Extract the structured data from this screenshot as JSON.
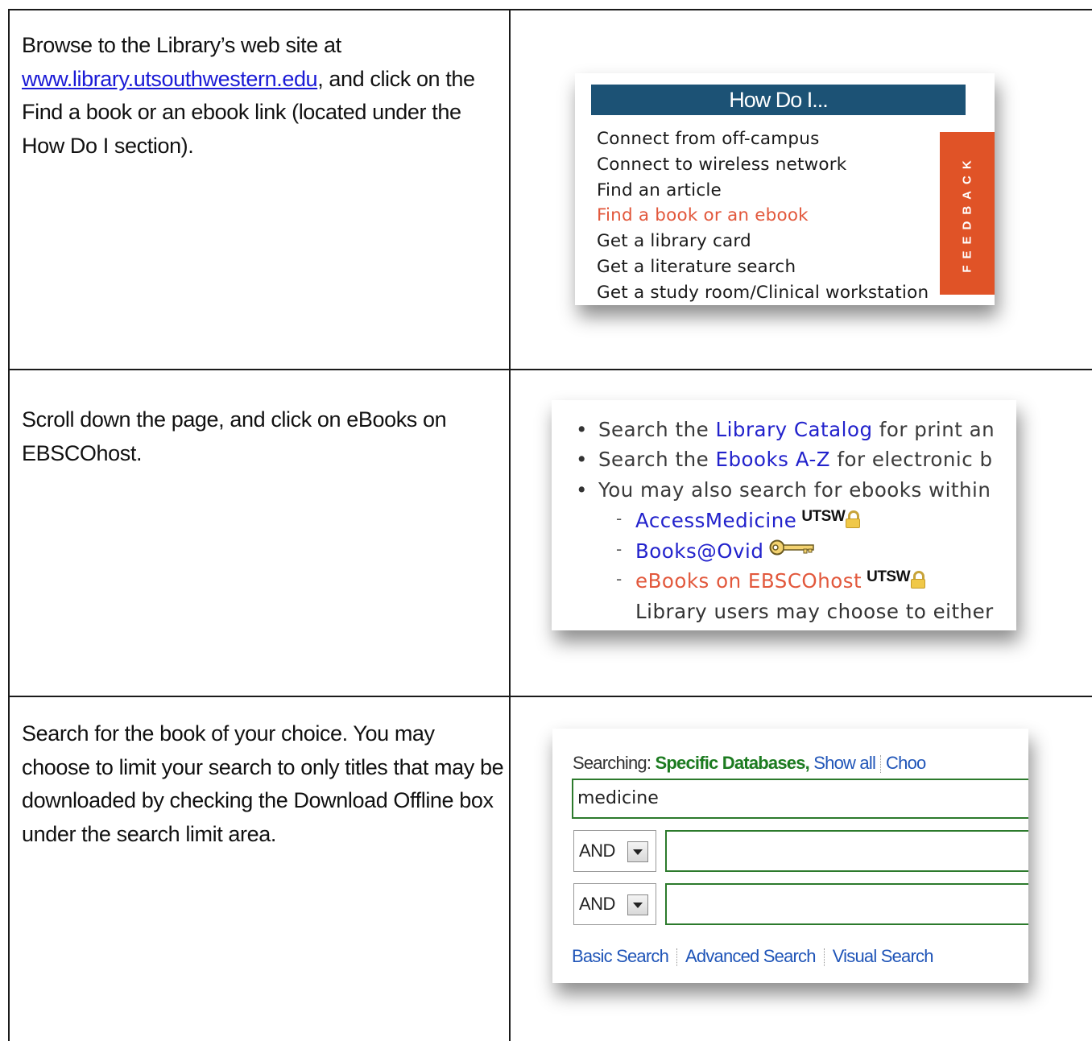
{
  "rows": [
    {
      "instruction_pre": "Browse to the Library’s web site at ",
      "instruction_link": "www.library.utsouthwestern.edu",
      "instruction_post": ", and click on the Find a book or an ebook link (located under the How Do I section)."
    },
    {
      "instruction": "Scroll down the page, and click on eBooks on EBSCOhost."
    },
    {
      "instruction": "Search for the book of your choice. You may choose to limit your search to only titles that may be downloaded by checking the Download Offline box under the search limit area."
    }
  ],
  "howdo": {
    "title": "How Do I...",
    "items": [
      "Connect from off-campus",
      "Connect to wireless network",
      "Find an article",
      "Find a book or an ebook",
      "Get a library card",
      "Get a literature search",
      "Get a study room/Clinical workstation"
    ],
    "active_index": 3,
    "feedback_label": "FEEDBACK",
    "colors": {
      "bar": "#1c5275",
      "feedback": "#e05327",
      "active": "#e2583c"
    }
  },
  "catalog": {
    "bullet1_pre": "Search the ",
    "bullet1_link": "Library Catalog",
    "bullet1_post": " for print an",
    "bullet2_pre": "Search the ",
    "bullet2_link": "Ebooks A-Z",
    "bullet2_post": " for electronic b",
    "bullet3": "You may also search for ebooks within",
    "sub1_link": "AccessMedicine",
    "sub1_badge": "UTSW",
    "sub1_icon": "lock-icon",
    "sub2_link": "Books@Ovid",
    "sub2_icon": "key-icon",
    "sub3_link": "eBooks on EBSCOhost",
    "sub3_badge": "UTSW",
    "sub3_icon": "lock-icon",
    "desc": "Library users may choose to either"
  },
  "ebsco": {
    "searching_label": "Searching: ",
    "searching_value": "Specific Databases,",
    "show_all": "Show all",
    "choose": "Choo",
    "query": "medicine",
    "bool1": "AND",
    "bool2": "AND",
    "tab_basic": "Basic Search",
    "tab_advanced": "Advanced Search",
    "tab_visual": "Visual Search",
    "colors": {
      "green": "#2c7a2c",
      "link": "#2055b8"
    }
  }
}
